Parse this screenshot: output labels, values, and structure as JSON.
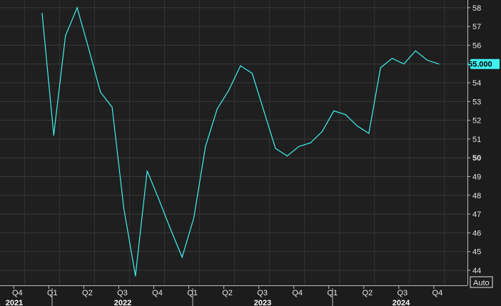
{
  "chart_data": {
    "type": "line",
    "title": "",
    "xlabel": "",
    "ylabel": "",
    "ylim": [
      43.5,
      58.4
    ],
    "grid": true,
    "y_ticks": [
      44,
      45,
      46,
      47,
      48,
      49,
      50,
      51,
      52,
      53,
      54,
      55,
      56,
      57,
      58
    ],
    "x_quarter_ticks": [
      "Q4",
      "Q1",
      "Q2",
      "Q3",
      "Q4",
      "Q1",
      "Q2",
      "Q3",
      "Q4",
      "Q1",
      "Q2",
      "Q3",
      "Q4"
    ],
    "x_year_labels": [
      "2021",
      "2022",
      "2023",
      "2024"
    ],
    "x": [
      "2021-12",
      "2022-01",
      "2022-02",
      "2022-03",
      "2022-04",
      "2022-05",
      "2022-06",
      "2022-07",
      "2022-08",
      "2022-09",
      "2022-10",
      "2022-11",
      "2022-12",
      "2023-01",
      "2023-02",
      "2023-03",
      "2023-04",
      "2023-05",
      "2023-06",
      "2023-07",
      "2023-08",
      "2023-09",
      "2023-10",
      "2023-11",
      "2023-12",
      "2024-01",
      "2024-02",
      "2024-03",
      "2024-04",
      "2024-05",
      "2024-06",
      "2024-07",
      "2024-08",
      "2024-09",
      "2024-10",
      "2024-11"
    ],
    "series": [
      {
        "color": "#40f0f0",
        "values": [
          57.7,
          51.2,
          56.5,
          58.0,
          55.8,
          53.5,
          52.7,
          47.3,
          43.7,
          49.3,
          47.8,
          46.2,
          44.7,
          46.8,
          50.6,
          52.6,
          53.6,
          54.9,
          54.5,
          52.5,
          50.5,
          50.1,
          50.6,
          50.8,
          51.4,
          52.5,
          52.3,
          51.7,
          51.3,
          54.8,
          55.3,
          55.0,
          55.7,
          55.2,
          55.0
        ]
      }
    ],
    "last_value_label": "55.000",
    "scale_mode": "Auto"
  }
}
